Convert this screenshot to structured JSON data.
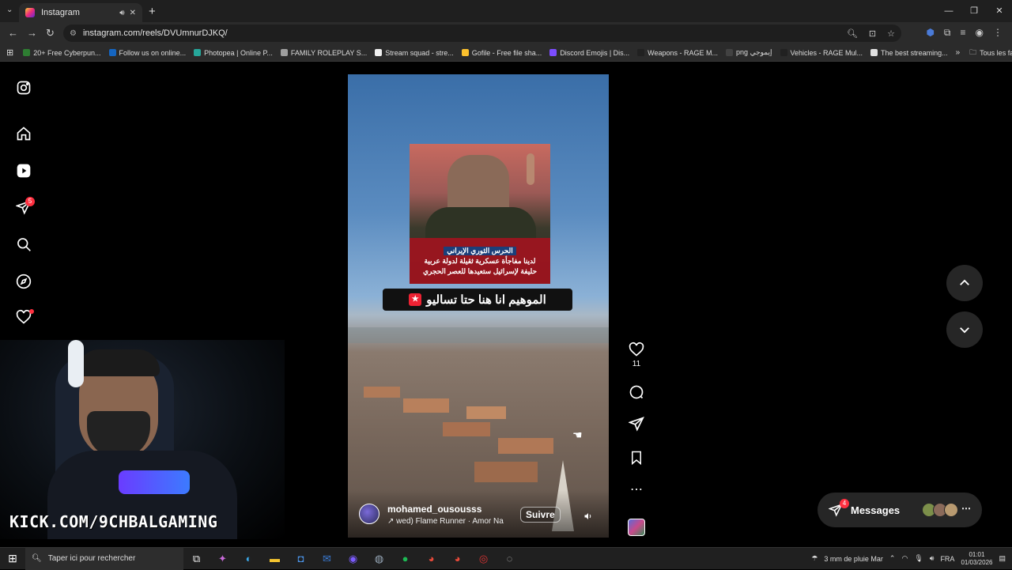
{
  "browser": {
    "tab_title": "Instagram",
    "url": "instagram.com/reels/DVUmnurDJKQ/",
    "bookmarks": [
      {
        "label": "20+ Free Cyberpun...",
        "color": "#2e7d32"
      },
      {
        "label": "Follow us on online...",
        "color": "#1565c0"
      },
      {
        "label": "Photopea | Online P...",
        "color": "#26a69a"
      },
      {
        "label": "FAMILY ROLEPLAY S...",
        "color": "#9e9e9e"
      },
      {
        "label": "Stream squad - stre...",
        "color": "#eeeeee"
      },
      {
        "label": "Gofile - Free file sha...",
        "color": "#fbc02d"
      },
      {
        "label": "Discord Emojis | Dis...",
        "color": "#7c4dff"
      },
      {
        "label": "Weapons - RAGE M...",
        "color": "#212121"
      },
      {
        "label": "png إيموجي",
        "color": "#424242"
      },
      {
        "label": "Vehicles - RAGE Mul...",
        "color": "#212121"
      },
      {
        "label": "The best streaming...",
        "color": "#e0e0e0"
      }
    ],
    "all_bookmarks_label": "Tous les favoris"
  },
  "sidebar": {
    "items": [
      {
        "name": "instagram-logo-icon"
      },
      {
        "name": "home-icon"
      },
      {
        "name": "reels-icon"
      },
      {
        "name": "messages-icon",
        "badge": "5"
      },
      {
        "name": "search-icon"
      },
      {
        "name": "explore-icon"
      },
      {
        "name": "notifications-icon"
      },
      {
        "name": "create-icon"
      }
    ]
  },
  "stream_overlay": {
    "kick_label": "KICK.COM/9CHBALGAMING"
  },
  "reel": {
    "inset_caption_title": "الحرس الثوري الإيراني",
    "inset_caption_line1": "لدينا مفاجأة عسكرية ثقيلة لدولة عربية",
    "inset_caption_line2": "حليفة لإسرائيل ستعيدها للعصر الحجري",
    "banner_text": "الموهيم انا هنا حتا تساليو",
    "author_name": "mohamed_ousousss",
    "audio_text": "wed)  Flame Runner · Amor Na",
    "follow_label": "Suivre",
    "like_count": "11"
  },
  "messages_pill": {
    "label": "Messages",
    "badge": "4"
  },
  "taskbar": {
    "search_placeholder": "Taper ici pour rechercher",
    "weather": "3 mm de pluie Mar",
    "language": "FRA",
    "time": "01:01",
    "date": "01/03/2026"
  }
}
